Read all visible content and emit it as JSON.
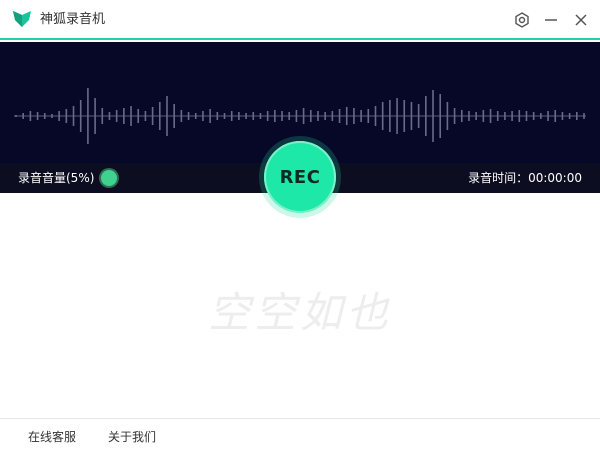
{
  "app": {
    "title": "神狐录音机"
  },
  "titlebar": {
    "buttons": [
      {
        "icon": "gear-icon"
      },
      {
        "icon": "minimize-icon"
      },
      {
        "icon": "close-icon"
      }
    ]
  },
  "status": {
    "volume_label": "录音音量(5%)",
    "volume_percent": 5,
    "time_label": "录音时间：",
    "time_value": "00:00:00"
  },
  "rec_button": {
    "label": "REC"
  },
  "empty_state": {
    "text": "空空如也"
  },
  "footer": {
    "service_label": "在线客服",
    "about_label": "关于我们"
  },
  "colors": {
    "accent": "#1ee8a8",
    "wave_bg": "#070828",
    "status_bg": "#0c0d20",
    "volume_dot": "#3fd18f"
  },
  "waveform": {
    "amplitudes": [
      1,
      3,
      5,
      4,
      3,
      2,
      5,
      7,
      10,
      16,
      28,
      18,
      8,
      4,
      6,
      8,
      10,
      7,
      5,
      9,
      14,
      20,
      12,
      6,
      4,
      3,
      5,
      7,
      4,
      3,
      5,
      4,
      3,
      4,
      3,
      5,
      6,
      5,
      4,
      6,
      8,
      6,
      5,
      4,
      5,
      7,
      9,
      8,
      6,
      7,
      10,
      14,
      16,
      18,
      16,
      14,
      12,
      20,
      26,
      22,
      14,
      8,
      6,
      5,
      4,
      6,
      7,
      5,
      4,
      5,
      6,
      5,
      4,
      3,
      5,
      6,
      4,
      3,
      4,
      3
    ]
  }
}
